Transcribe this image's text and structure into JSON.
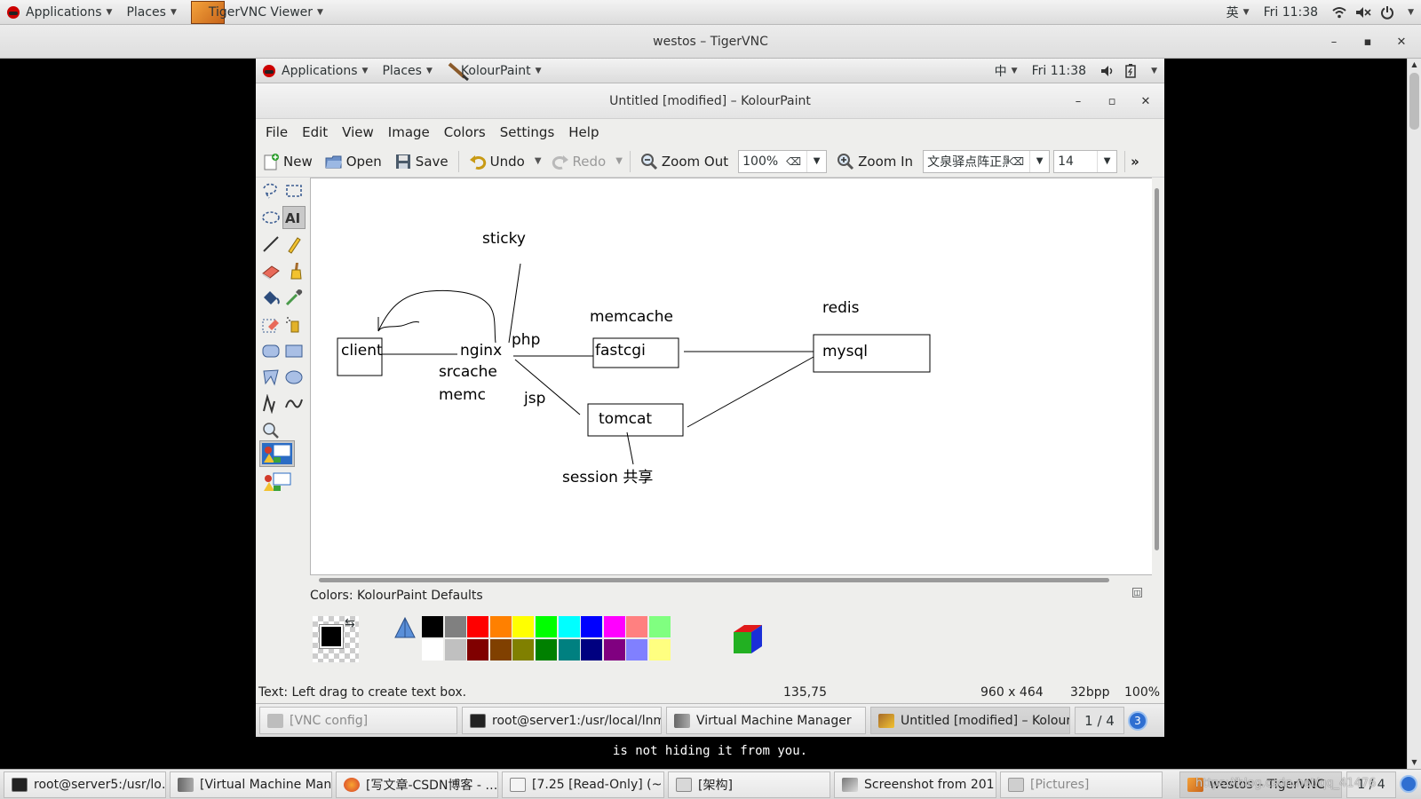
{
  "top_bar": {
    "applications": "Applications",
    "places": "Places",
    "active_app": "TigerVNC Viewer",
    "input_method": "英",
    "clock": "Fri 11:38"
  },
  "vnc_window": {
    "title": "westos – TigerVNC"
  },
  "inner_bar": {
    "applications": "Applications",
    "places": "Places",
    "active_app": "KolourPaint",
    "input_method": "中",
    "clock": "Fri 11:38"
  },
  "kolourpaint": {
    "title": "Untitled [modified] – KolourPaint",
    "menu": [
      "File",
      "Edit",
      "View",
      "Image",
      "Colors",
      "Settings",
      "Help"
    ],
    "toolbar": {
      "new": "New",
      "open": "Open",
      "save": "Save",
      "undo": "Undo",
      "redo": "Redo",
      "zoom_out": "Zoom Out",
      "zoom_value": "100%",
      "zoom_in": "Zoom In",
      "font_value": "文泉驿点阵正黑",
      "font_size": "14",
      "more": "»"
    },
    "canvas_labels": {
      "sticky": "sticky",
      "client": "client",
      "nginx": "nginx",
      "srcache": "srcache",
      "memc": "memc",
      "php": "php",
      "jsp": "jsp",
      "memcache": "memcache",
      "fastcgi": "fastcgi",
      "tomcat": "tomcat",
      "session": "session 共享",
      "redis": "redis",
      "mysql": "mysql"
    },
    "colors_label": "Colors: KolourPaint Defaults",
    "palette_top": [
      "#000000",
      "#808080",
      "#ff0000",
      "#ff8000",
      "#ffff00",
      "#00ff00",
      "#00ffff",
      "#0000ff",
      "#ff00ff",
      "#ff8080",
      "#80ff80"
    ],
    "palette_bottom": [
      "#ffffff",
      "#c0c0c0",
      "#800000",
      "#804000",
      "#808000",
      "#008000",
      "#008080",
      "#000080",
      "#800080",
      "#8080ff",
      "#ffff80"
    ],
    "status": {
      "message": "Text: Left drag to create text box.",
      "coords": "135,75",
      "dimensions": "960 x 464",
      "depth": "32bpp",
      "zoom": "100%"
    }
  },
  "inner_taskbar": {
    "items": [
      "[VNC config]",
      "root@server1:/usr/local/lnm…",
      "Virtual Machine Manager",
      "Untitled [modified] – Kolour…"
    ],
    "pager": "1 / 4",
    "badge": "3"
  },
  "terminal_message": "is not hiding it from you.",
  "outer_taskbar": {
    "items": [
      "root@server5:/usr/lo…",
      "[Virtual Machine Mana…",
      "[写文章-CSDN博客 - …",
      "[7.25 [Read-Only] (~…",
      "[架构]",
      "Screenshot from 201…",
      "[Pictures]",
      "westos – TigerVNC"
    ],
    "pager": "1 / 4",
    "watermark": "https://blog.csdn.net/qq_41476"
  }
}
